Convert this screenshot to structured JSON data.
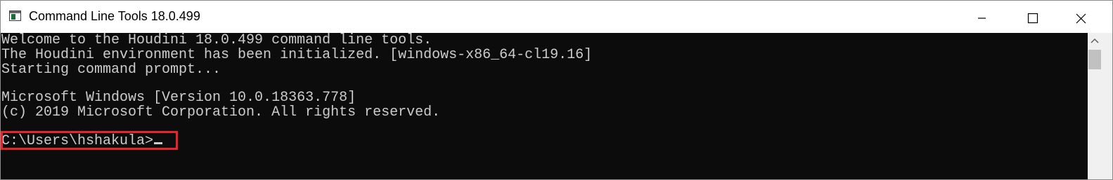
{
  "window": {
    "title": "Command Line Tools 18.0.499",
    "icon": "console-icon",
    "controls": [
      "minimize-icon",
      "maximize-icon",
      "close-icon"
    ]
  },
  "console": {
    "lines": [
      "Welcome to the Houdini 18.0.499 command line tools.",
      "The Houdini environment has been initialized. [windows-x86_64-cl19.16]",
      "Starting command prompt...",
      "",
      "Microsoft Windows [Version 10.0.18363.778]",
      "(c) 2019 Microsoft Corporation. All rights reserved.",
      ""
    ],
    "prompt": "C:\\Users\\hshakula>"
  },
  "colors": {
    "console_background": "#0c0c0c",
    "console_text": "#cccccc",
    "highlight_border": "#e8232a",
    "titlebar_background": "#ffffff"
  }
}
